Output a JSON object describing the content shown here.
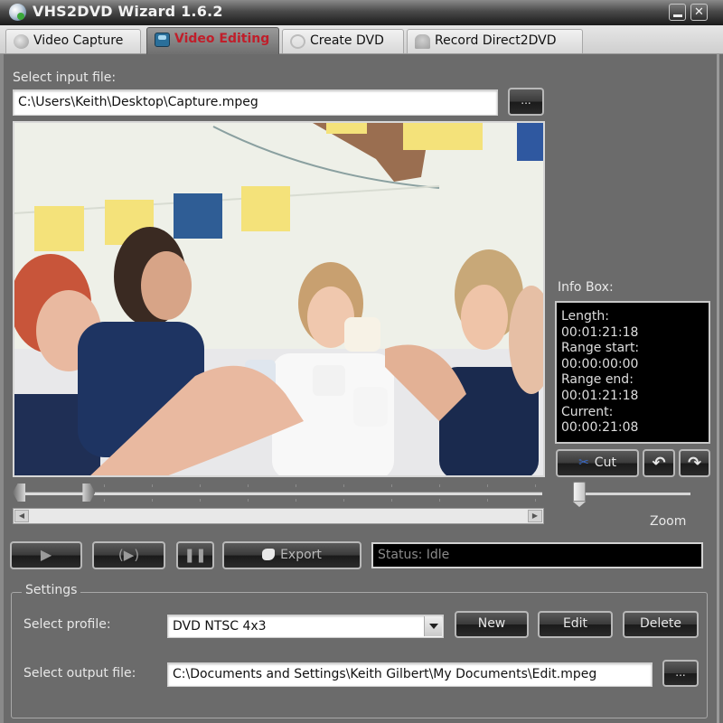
{
  "window": {
    "title": "VHS2DVD Wizard 1.6.2",
    "minimize_icon": "minimize-icon",
    "close_label": "✕"
  },
  "tabs": [
    {
      "label": "Video Capture",
      "icon": "camera-icon",
      "active": false
    },
    {
      "label": "Video Editing",
      "icon": "film-editing-icon",
      "active": true
    },
    {
      "label": "Create DVD",
      "icon": "disc-icon",
      "active": false
    },
    {
      "label": "Record Direct2DVD",
      "icon": "record-icon",
      "active": false
    }
  ],
  "input": {
    "label": "Select input file:",
    "value": "C:\\Users\\Keith\\Desktop\\Capture.mpeg",
    "browse_label": "..."
  },
  "info": {
    "heading": "Info Box:",
    "lines": [
      "Length:",
      "00:01:21:18",
      "Range start:",
      "00:00:00:00",
      "Range end:",
      "00:01:21:18",
      "Current:",
      "00:00:21:08"
    ]
  },
  "editing": {
    "cut_label": "Cut",
    "undo_icon": "undo-icon",
    "redo_icon": "redo-icon",
    "zoom_label": "Zoom",
    "zoom_level": 0,
    "position_fraction": 0.12
  },
  "playback": {
    "play_icon": "▶",
    "play_range_icon": "(▶)",
    "pause_icon": "❚❚",
    "export_label": "Export",
    "status": "Status: Idle"
  },
  "settings": {
    "legend": "Settings",
    "profile_label": "Select profile:",
    "profile_value": "DVD NTSC 4x3",
    "new_label": "New",
    "edit_label": "Edit",
    "delete_label": "Delete",
    "output_label": "Select output file:",
    "output_value": "C:\\Documents and Settings\\Keith Gilbert\\My Documents\\Edit.mpeg",
    "browse_label": "..."
  },
  "colors": {
    "background": "#6b6b6b",
    "active_tab_text": "#c01e2a",
    "info_bg": "#000000"
  }
}
